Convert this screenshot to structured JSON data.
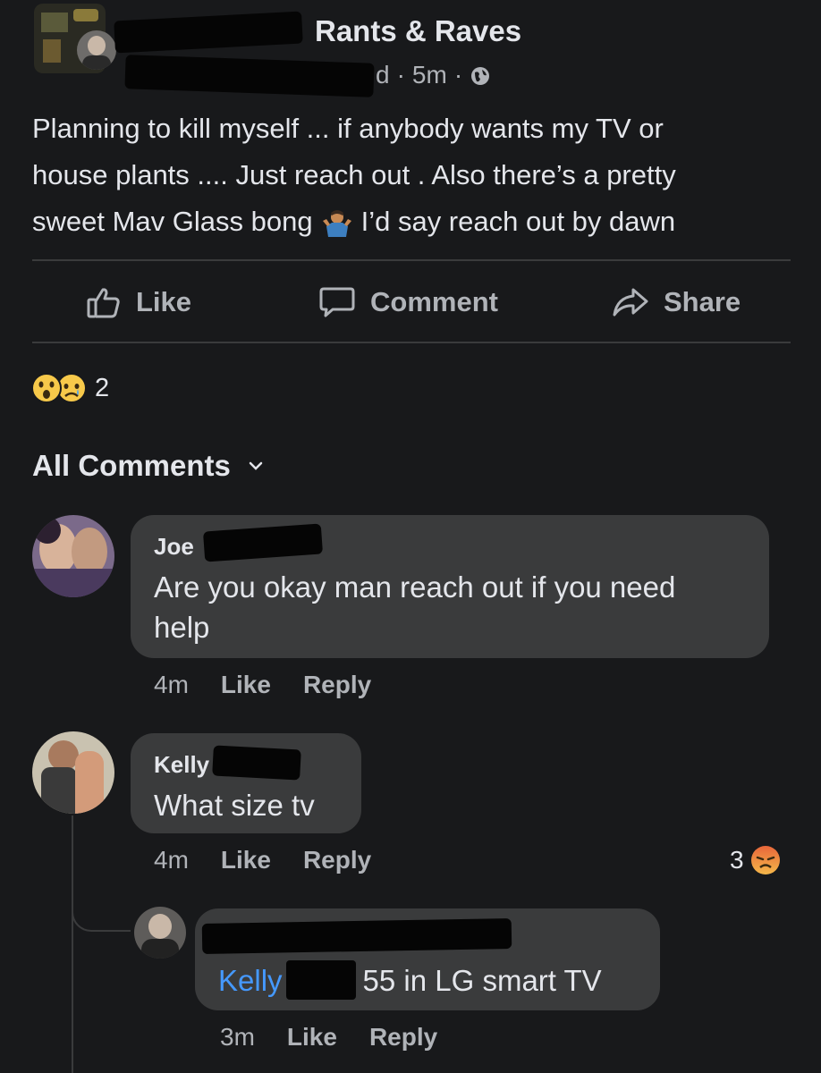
{
  "post": {
    "group_name": "Rants & Raves",
    "time": "5m",
    "meta_sep": "·",
    "author_fragment": "d",
    "body_line1": "Planning to kill myself ... if anybody wants my TV or",
    "body_line2": "house plants .... Just reach out . Also there’s a pretty",
    "body_line3a": "sweet Mav Glass bong",
    "body_line3b": "I’d say reach out by dawn",
    "reaction_count": "2"
  },
  "actions": {
    "like": "Like",
    "comment": "Comment",
    "share": "Share"
  },
  "comments_header": "All Comments",
  "comments": [
    {
      "name": "Joe",
      "line1": "Are you okay man reach out if you need",
      "line2": "help",
      "time": "4m",
      "like": "Like",
      "reply": "Reply"
    },
    {
      "name": "Kelly",
      "line1": "What size tv",
      "time": "4m",
      "like": "Like",
      "reply": "Reply",
      "reaction_count": "3"
    }
  ],
  "reply": {
    "mention": "Kelly",
    "text": "55 in LG smart TV",
    "time": "3m",
    "like": "Like",
    "reply": "Reply"
  },
  "colors": {
    "background": "#18191b",
    "bubble": "#3a3b3c",
    "mention": "#4599ff",
    "text": "#e4e6eb",
    "muted": "#b0b3b8"
  }
}
